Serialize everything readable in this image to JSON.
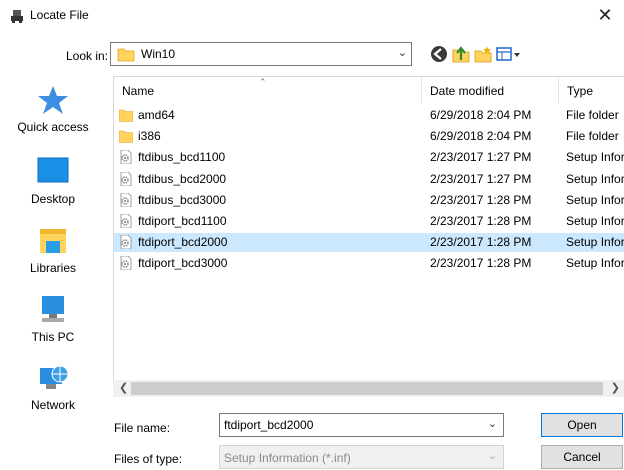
{
  "window": {
    "title": "Locate File",
    "close_glyph": "✕"
  },
  "lookin": {
    "label": "Look in:",
    "value": "Win10"
  },
  "toolbar": {
    "icons": [
      "back-icon",
      "up-folder-icon",
      "new-folder-icon",
      "view-menu-icon"
    ]
  },
  "places": [
    {
      "label": "Quick access",
      "icon": "star-icon"
    },
    {
      "label": "Desktop",
      "icon": "desktop-icon"
    },
    {
      "label": "Libraries",
      "icon": "libraries-icon"
    },
    {
      "label": "This PC",
      "icon": "computer-icon"
    },
    {
      "label": "Network",
      "icon": "network-icon"
    }
  ],
  "columns": {
    "name": "Name",
    "date": "Date modified",
    "type": "Type"
  },
  "files": [
    {
      "name": "amd64",
      "date": "6/29/2018 2:04 PM",
      "type": "File folder",
      "kind": "folder",
      "selected": false
    },
    {
      "name": "i386",
      "date": "6/29/2018 2:04 PM",
      "type": "File folder",
      "kind": "folder",
      "selected": false
    },
    {
      "name": "ftdibus_bcd1100",
      "date": "2/23/2017 1:27 PM",
      "type": "Setup Information",
      "kind": "inf",
      "selected": false
    },
    {
      "name": "ftdibus_bcd2000",
      "date": "2/23/2017 1:27 PM",
      "type": "Setup Information",
      "kind": "inf",
      "selected": false
    },
    {
      "name": "ftdibus_bcd3000",
      "date": "2/23/2017 1:28 PM",
      "type": "Setup Information",
      "kind": "inf",
      "selected": false
    },
    {
      "name": "ftdiport_bcd1100",
      "date": "2/23/2017 1:28 PM",
      "type": "Setup Information",
      "kind": "inf",
      "selected": false
    },
    {
      "name": "ftdiport_bcd2000",
      "date": "2/23/2017 1:28 PM",
      "type": "Setup Information",
      "kind": "inf",
      "selected": true
    },
    {
      "name": "ftdiport_bcd3000",
      "date": "2/23/2017 1:28 PM",
      "type": "Setup Information",
      "kind": "inf",
      "selected": false
    }
  ],
  "filename": {
    "label": "File name:",
    "value": "ftdiport_bcd2000"
  },
  "filetype": {
    "label": "Files of type:",
    "value": "Setup Information (*.inf)"
  },
  "buttons": {
    "open": "Open",
    "cancel": "Cancel"
  },
  "colors": {
    "selection": "#cce8ff",
    "accent": "#0078d7",
    "folder": "#ffd35c"
  }
}
